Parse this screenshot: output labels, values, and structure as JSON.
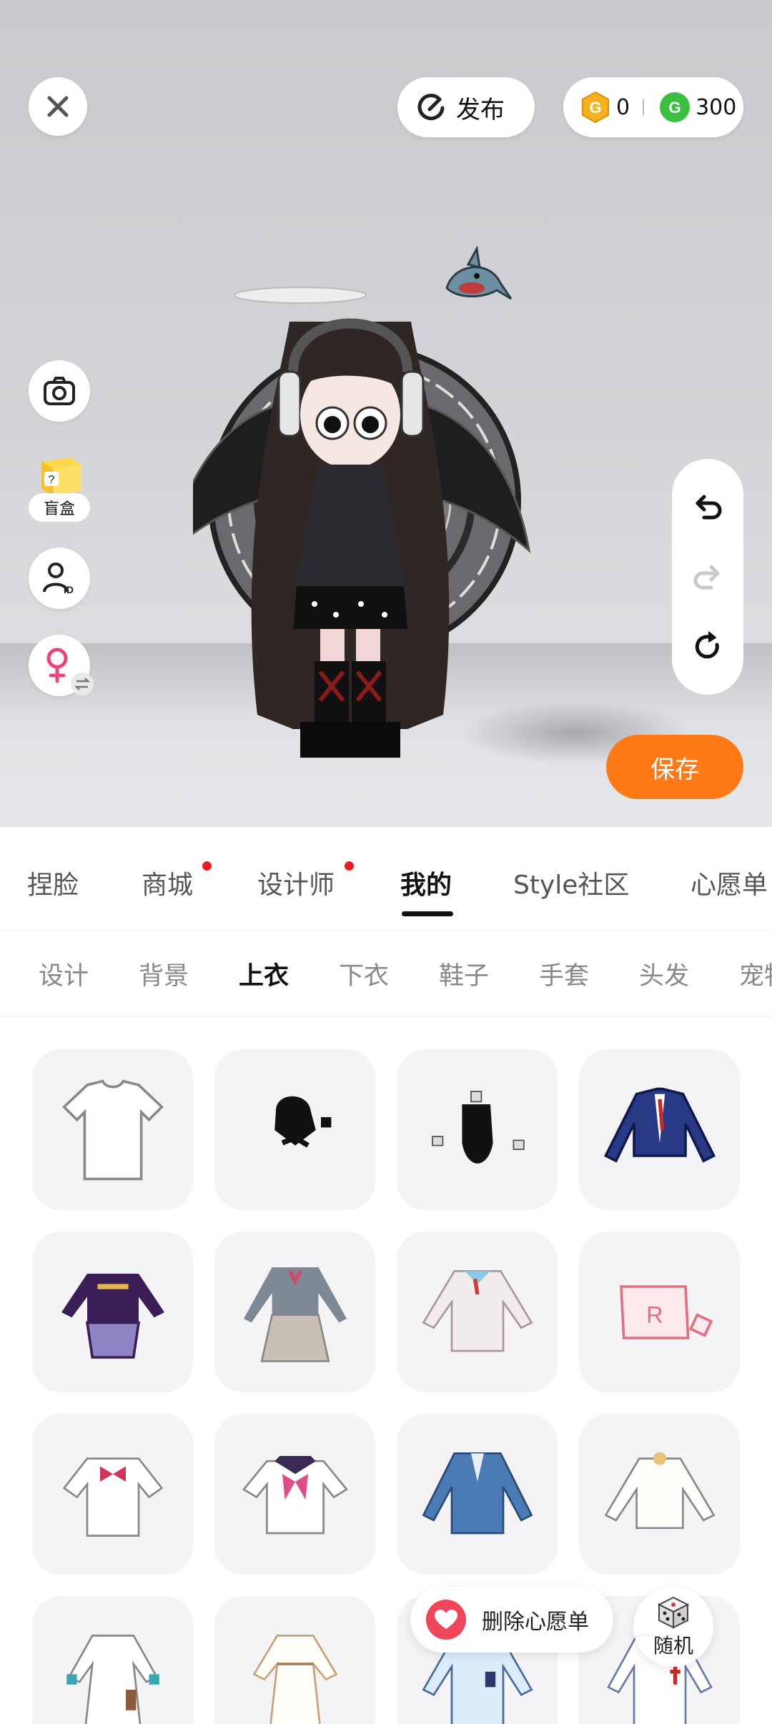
{
  "top_bar": {
    "publish_label": "发布",
    "coins": [
      {
        "icon": "gold-coin-icon",
        "value": "0",
        "color": "#f4b21b"
      },
      {
        "icon": "green-coin-icon",
        "value": "300",
        "color": "#3bbf3f"
      }
    ]
  },
  "left_tools": {
    "blind_box_label": "盲盒"
  },
  "save_label": "保存",
  "main_tabs": [
    {
      "label": "捏脸",
      "dot": false
    },
    {
      "label": "商城",
      "dot": true
    },
    {
      "label": "设计师",
      "dot": true
    },
    {
      "label": "我的",
      "dot": false,
      "active": true
    },
    {
      "label": "Style社区",
      "dot": false
    },
    {
      "label": "心愿单",
      "dot": false
    }
  ],
  "sub_tabs": [
    {
      "label": "设计"
    },
    {
      "label": "背景"
    },
    {
      "label": "上衣",
      "active": true
    },
    {
      "label": "下衣"
    },
    {
      "label": "鞋子"
    },
    {
      "label": "手套"
    },
    {
      "label": "头发"
    },
    {
      "label": "宠物"
    }
  ],
  "items": [
    "white-tshirt",
    "black-tie-top",
    "black-bodysuit",
    "navy-blazer",
    "purple-sweater-plaid-skirt",
    "grey-school-uniform",
    "white-cardigan",
    "pink-crop-top",
    "white-blouse-red-bow",
    "sailor-top-pink-bow",
    "blue-denim-jacket",
    "white-ruffle-blouse",
    "white-dress-teal-cuffs",
    "white-long-dress",
    "light-blue-shirt",
    "white-apron-shirt"
  ],
  "floating": {
    "wishlist_remove_label": "删除心愿单",
    "random_label": "随机"
  },
  "colors": {
    "accent": "#ff7a14",
    "tab_dot": "#ee1c25",
    "heart": "#f0465a"
  }
}
